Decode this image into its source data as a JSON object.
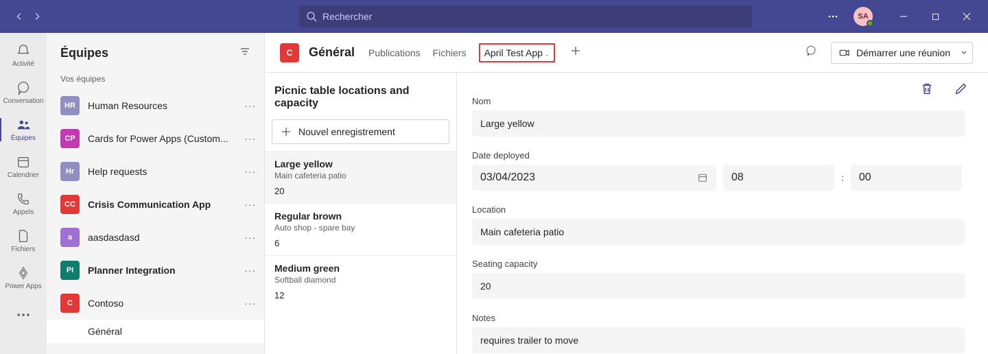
{
  "titlebar": {
    "search_placeholder": "Rechercher",
    "avatar_initials": "SA"
  },
  "rail": {
    "activity": "Activité",
    "chat": "Conversation",
    "teams": "Équipes",
    "calendar": "Calendrier",
    "calls": "Appels",
    "files": "Fichiers",
    "powerapps": "Power Apps"
  },
  "teams_panel": {
    "title": "Équipes",
    "section_label": "Vos équipes",
    "items": [
      {
        "initials": "HR",
        "name": "Human Resources",
        "color": "#8f90c1",
        "bold": false
      },
      {
        "initials": "CP",
        "name": "Cards for Power Apps (Custom...",
        "color": "#c239b3",
        "bold": false
      },
      {
        "initials": "Hr",
        "name": "Help requests",
        "color": "#8f90c1",
        "bold": false
      },
      {
        "initials": "CC",
        "name": "Crisis Communication App",
        "color": "#e23838",
        "bold": true
      },
      {
        "initials": "a",
        "name": "aasdasdasd",
        "color": "#a06fd6",
        "bold": false
      },
      {
        "initials": "PI",
        "name": "Planner Integration",
        "color": "#0f7c6c",
        "bold": true
      },
      {
        "initials": "C",
        "name": "Contoso",
        "color": "#e23838",
        "bold": false
      }
    ],
    "channel": "Général"
  },
  "channel_header": {
    "avatar_initial": "C",
    "name": "Général",
    "tabs": {
      "posts": "Publications",
      "files": "Fichiers",
      "app": "April Test App"
    },
    "meet_label": "Démarrer une réunion"
  },
  "records": {
    "title": "Picnic table locations and capacity",
    "new_label": "Nouvel enregistrement",
    "items": [
      {
        "name": "Large yellow",
        "sub": "Main cafeteria patio",
        "num": "20"
      },
      {
        "name": "Regular brown",
        "sub": "Auto shop - spare bay",
        "num": "6"
      },
      {
        "name": "Medium green",
        "sub": "Softball diamond",
        "num": "12"
      }
    ]
  },
  "detail": {
    "labels": {
      "nom": "Nom",
      "date": "Date deployed",
      "location": "Location",
      "capacity": "Seating capacity",
      "notes": "Notes"
    },
    "values": {
      "nom": "Large yellow",
      "date": "03/04/2023",
      "hour": "08",
      "minute": "00",
      "location": "Main cafeteria patio",
      "capacity": "20",
      "notes": "requires trailer to move"
    }
  }
}
